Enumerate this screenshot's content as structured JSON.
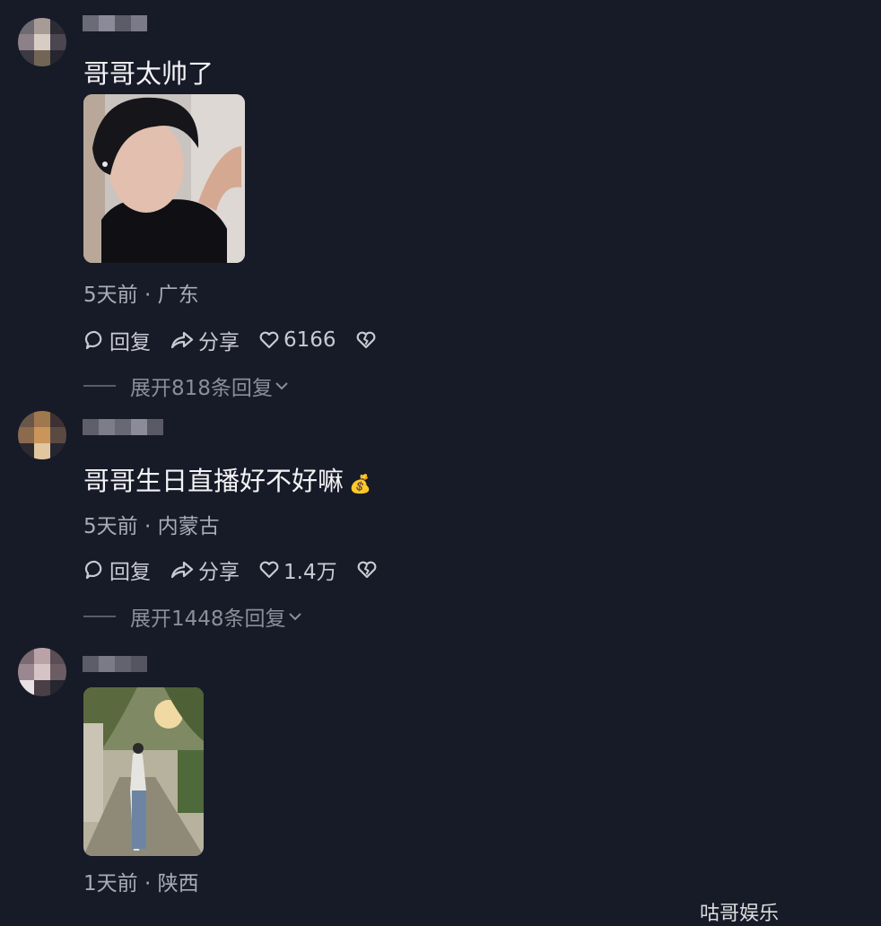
{
  "comments": [
    {
      "text": "哥哥太帅了",
      "meta": "5天前 · 广东",
      "reply_label": "回复",
      "share_label": "分享",
      "like_count": "6166",
      "expand_label": "展开818条回复"
    },
    {
      "text": "哥哥生日直播好不好嘛",
      "emoji": "💰",
      "meta": "5天前 · 内蒙古",
      "reply_label": "回复",
      "share_label": "分享",
      "like_count": "1.4万",
      "expand_label": "展开1448条回复"
    },
    {
      "meta": "1天前 · 陕西"
    }
  ],
  "watermark": "咕哥娱乐",
  "icons": {
    "reply": "speech-bubble-icon",
    "share": "share-arrow-icon",
    "like": "heart-icon",
    "dislike": "broken-heart-icon",
    "expand": "chevron-down-icon"
  },
  "colors": {
    "background": "#171a27",
    "comment_text": "#f4f4f6",
    "meta_text": "#a9abb5",
    "action_text": "#c9cad2"
  }
}
